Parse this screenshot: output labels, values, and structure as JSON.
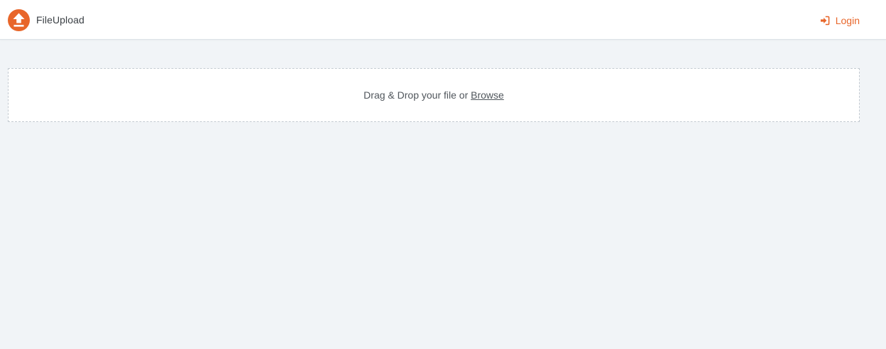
{
  "header": {
    "brand_name": "FileUpload",
    "logo_icon": "upload-arrow-icon",
    "login_label": "Login",
    "login_icon": "sign-in-icon"
  },
  "upload": {
    "prompt_text": "Drag & Drop your file or ",
    "browse_label": "Browse"
  },
  "colors": {
    "accent": "#e8662a",
    "background": "#f1f4f7",
    "surface": "#ffffff",
    "text": "#50565c"
  }
}
